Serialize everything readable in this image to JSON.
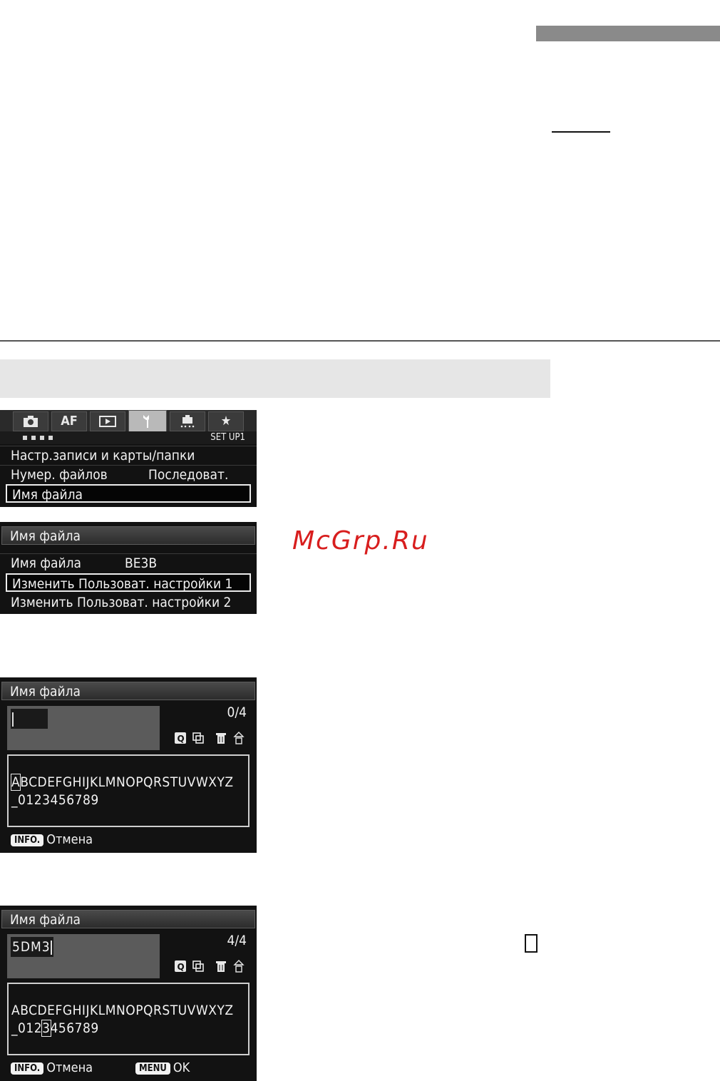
{
  "watermark": "McGrp.Ru",
  "screen1": {
    "tabs": [
      "■",
      "AF",
      "▶",
      "⚒",
      "∴",
      "★"
    ],
    "page_label": "SET UP1",
    "items": [
      {
        "label": "Настр.записи и карты/папки",
        "value": ""
      },
      {
        "label": "Нумер. файлов",
        "value": "Последоват."
      },
      {
        "label": "Имя файла",
        "value": ""
      }
    ]
  },
  "screen2": {
    "title": "Имя файла",
    "items": [
      {
        "label": "Имя файла",
        "value": "BE3B"
      },
      {
        "label": "Изменить Пользоват. настройки 1",
        "value": ""
      },
      {
        "label": "Изменить Пользоват. настройки 2",
        "value": ""
      }
    ]
  },
  "screen3": {
    "title": "Имя файла",
    "entry": "",
    "counter": "0/4",
    "row1_cursor": "A",
    "row1_rest": "BCDEFGHIJKLMNOPQRSTUVWXYZ",
    "row2": "_0123456789",
    "info_btn": "INFO.",
    "cancel": "Отмена"
  },
  "screen4": {
    "title": "Имя файла",
    "entry": "5DM3",
    "counter": "4/4",
    "row1": "ABCDEFGHIJKLMNOPQRSTUVWXYZ",
    "row2_pre": "_012",
    "row2_cursor": "3",
    "row2_post": "456789",
    "info_btn": "INFO.",
    "cancel": "Отмена",
    "menu_btn": "MENU",
    "ok": "OK"
  }
}
